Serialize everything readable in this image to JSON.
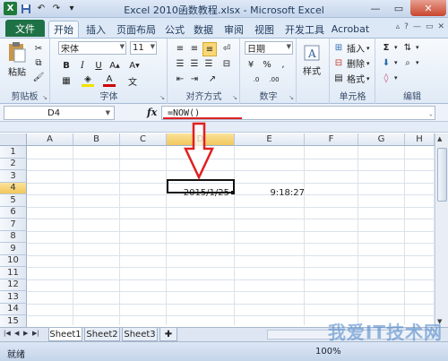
{
  "window": {
    "title": "Excel 2010函数教程.xlsx - Microsoft Excel",
    "app_icon": "X",
    "accent_color": "#1e7145"
  },
  "ribbon_tabs": [
    {
      "label": "文件",
      "active": false
    },
    {
      "label": "开始",
      "active": true
    },
    {
      "label": "插入",
      "active": false
    },
    {
      "label": "页面布局",
      "active": false
    },
    {
      "label": "公式",
      "active": false
    },
    {
      "label": "数据",
      "active": false
    },
    {
      "label": "审阅",
      "active": false
    },
    {
      "label": "视图",
      "active": false
    },
    {
      "label": "开发工具",
      "active": false
    },
    {
      "label": "Acrobat",
      "active": false
    }
  ],
  "ribbon": {
    "clipboard": {
      "paste_label": "粘贴",
      "group_label": "剪贴板"
    },
    "font": {
      "font_name": "宋体",
      "font_size": "11",
      "group_label": "字体",
      "bold": "B",
      "italic": "I",
      "underline": "U"
    },
    "alignment": {
      "group_label": "对齐方式"
    },
    "number": {
      "format": "日期",
      "group_label": "数字",
      "percent": "%",
      "comma": ","
    },
    "styles": {
      "label": "样式"
    },
    "cells": {
      "insert": "插入",
      "delete": "删除",
      "format": "格式",
      "group_label": "单元格"
    },
    "editing": {
      "group_label": "编辑",
      "sum": "Σ"
    }
  },
  "formula_bar": {
    "name_box": "D4",
    "fx": "fx",
    "formula": "=NOW()"
  },
  "grid": {
    "columns": [
      "A",
      "B",
      "C",
      "D",
      "E",
      "F",
      "G",
      "H"
    ],
    "rows": [
      "1",
      "2",
      "3",
      "4",
      "5",
      "6",
      "7",
      "8",
      "9",
      "10",
      "11",
      "12",
      "13",
      "14",
      "15"
    ],
    "selected_column": "D",
    "selected_row": "4",
    "cells": {
      "D4": "2015/1/25",
      "E4": "9:18:27"
    }
  },
  "sheet_tabs": [
    "Sheet1",
    "Sheet2",
    "Sheet3"
  ],
  "status": {
    "text": "就绪",
    "zoom": "100%"
  },
  "watermark": "我爱IT技术网"
}
